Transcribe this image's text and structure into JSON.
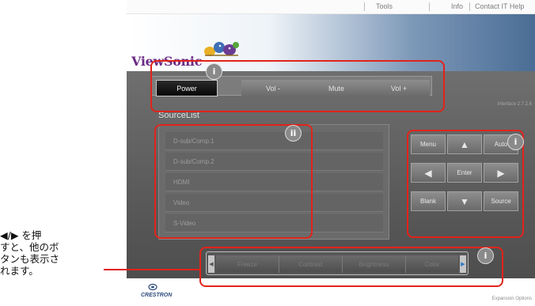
{
  "topnav": {
    "tools": "Tools",
    "info": "Info",
    "contact": "Contact IT Help"
  },
  "brand": {
    "logo_text": "ViewSonic"
  },
  "power_bar": {
    "power": "Power",
    "vol_down": "Vol -",
    "mute": "Mute",
    "vol_up": "Vol +"
  },
  "interface_version": "Interface 2.7.2.6",
  "source_list": {
    "title": "SourceList",
    "items": [
      "D-sub/Comp.1",
      "D-sub/Comp.2",
      "HDMI",
      "Video",
      "S-Video"
    ]
  },
  "nav_pad": {
    "menu": "Menu",
    "up": "▲",
    "auto": "Auto",
    "left": "◀",
    "enter": "Enter",
    "right": "▶",
    "blank": "Blank",
    "down": "▼",
    "source": "Source"
  },
  "scroll_bar": {
    "items": [
      "Freeze",
      "Contrast",
      "Brightness",
      "Color"
    ],
    "left_arrow": "◀",
    "right_arrow": "▶"
  },
  "footer": {
    "crestron": "CRESTRON",
    "expansion": "Expansion Options"
  },
  "badges": {
    "i": "i",
    "ii": "ii"
  },
  "annotation": {
    "line1": "◀/▶ を押",
    "line2": "すと、他のボ",
    "line3": "タンも表示さ",
    "line4": "れます。"
  },
  "colors": {
    "highlight": "#e2231a",
    "brand": "#6b2b86"
  }
}
